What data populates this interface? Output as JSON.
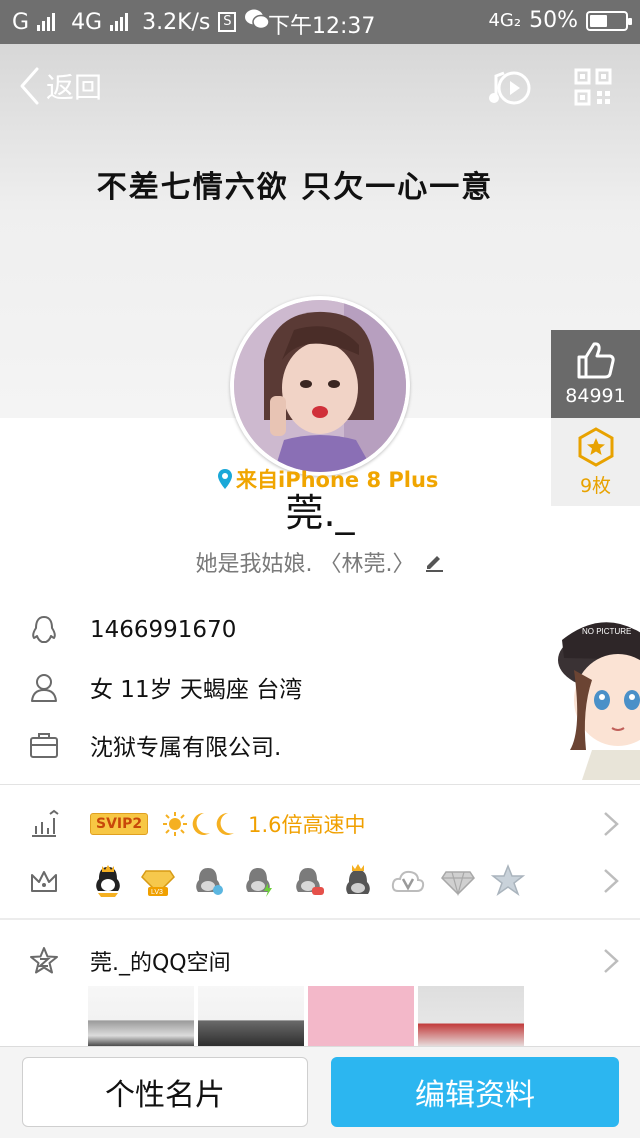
{
  "status_bar": {
    "carrier1": "G",
    "carrier2": "4G",
    "speed": "3.2K/s",
    "time": "下午12:37",
    "network": "4G₂",
    "battery": "50%",
    "battery_level": 0.5
  },
  "header": {
    "back_label": "返回",
    "motto": "不差七情六欲 只欠一心一意"
  },
  "profile": {
    "device": "来自iPhone 8 Plus",
    "nickname": "莞._",
    "signature": "她是我姑娘. 〈林莞.〉"
  },
  "side": {
    "likes": "84991",
    "medals": "9枚"
  },
  "info": {
    "qq_number": "1466991670",
    "personal": "女  11岁  天蝎座  台湾",
    "company": "沈狱专属有限公司."
  },
  "vip": {
    "badge": "SVIP2",
    "speed": "1.6倍高速中"
  },
  "qzone": {
    "title": "莞._的QQ空间"
  },
  "buttons": {
    "card": "个性名片",
    "edit": "编辑资料"
  },
  "colors": {
    "accent_blue": "#2CB6F0",
    "gold": "#F0A500",
    "status_bar": "#6F6F6F"
  }
}
